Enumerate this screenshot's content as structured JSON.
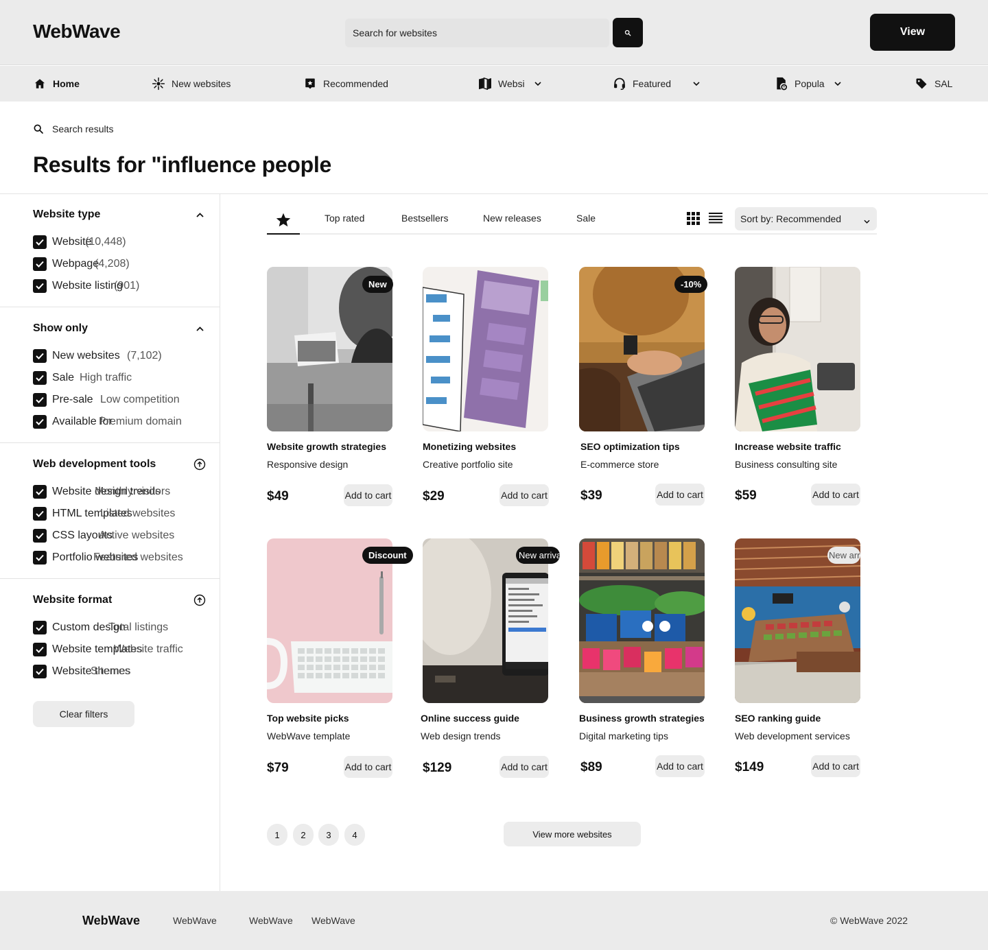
{
  "header": {
    "logo": "WebWave",
    "search_placeholder": "Search for websites",
    "view_label": "View"
  },
  "nav": {
    "items": [
      {
        "label": "Home",
        "icon": "home-icon"
      },
      {
        "label": "New websites",
        "icon": "sparkle-icon"
      },
      {
        "label": "Recommended",
        "icon": "recommend-icon"
      },
      {
        "label": "Websi",
        "icon": "book-icon"
      },
      {
        "label": "Featured",
        "icon": "headset-icon"
      },
      {
        "label": "Popula",
        "icon": "document-badge-icon"
      },
      {
        "label": "SAL",
        "icon": "tag-icon"
      }
    ]
  },
  "breadcrumb": "Search results",
  "page_title": "Results for \"influence people",
  "filters": {
    "website_type": {
      "title": "Website type",
      "options": [
        {
          "label": "Website",
          "count": "(10,448)"
        },
        {
          "label": "Webpage",
          "count": "(4,208)"
        },
        {
          "label": "Website listing",
          "count": "(901)"
        }
      ]
    },
    "show_only": {
      "title": "Show only",
      "options": [
        {
          "label": "New websites",
          "count": "(7,102)"
        },
        {
          "label": "Sale",
          "count": "High traffic"
        },
        {
          "label": "Pre-sale",
          "count": "Low competition"
        },
        {
          "label": "Available for",
          "count": "Premium domain"
        }
      ]
    },
    "web_dev_tools": {
      "title": "Web development tools",
      "options": [
        {
          "label": "Website design trends",
          "count": "Monthly visitors"
        },
        {
          "label": "HTML templates",
          "count": "Listed websites"
        },
        {
          "label": "CSS layouts",
          "count": "Active websites"
        },
        {
          "label": "Portfolio websites",
          "count": "Featured websites"
        }
      ]
    },
    "website_format": {
      "title": "Website format",
      "options": [
        {
          "label": "Custom design",
          "count": "Total listings"
        },
        {
          "label": "Website templates",
          "count": "Website traffic"
        },
        {
          "label": "Website themes",
          "count": "Sitemes"
        }
      ]
    },
    "clear_label": "Clear filters"
  },
  "toolbar": {
    "tabs": [
      "Top rated",
      "Bestsellers",
      "New releases",
      "Sale"
    ],
    "sort_label": "Sort by: Recommended"
  },
  "products": [
    {
      "title": "Website growth strategies",
      "subtitle": "Responsive design",
      "price": "$49",
      "cart": "Add to cart",
      "badge": "New"
    },
    {
      "title": "Monetizing websites",
      "subtitle": "Creative portfolio site",
      "price": "$29",
      "cart": "Add to cart",
      "badge": ""
    },
    {
      "title": "SEO optimization tips",
      "subtitle": "E-commerce store",
      "price": "$39",
      "cart": "Add to cart",
      "badge": "-10%"
    },
    {
      "title": "Increase website traffic",
      "subtitle": "Business consulting site",
      "price": "$59",
      "cart": "Add to cart",
      "badge": ""
    },
    {
      "title": "Top website picks",
      "subtitle": "WebWave template",
      "price": "$79",
      "cart": "Add to cart",
      "badge": "Discount"
    },
    {
      "title": "Online success guide",
      "subtitle": "Web design trends",
      "price": "$129",
      "cart": "Add to cart",
      "badge": "New arriva"
    },
    {
      "title": "Business growth strategies",
      "subtitle": "Digital marketing tips",
      "price": "$89",
      "cart": "Add to cart",
      "badge": ""
    },
    {
      "title": "SEO ranking guide",
      "subtitle": "Web development services",
      "price": "$149",
      "cart": "Add to cart",
      "badge": "New arriva"
    }
  ],
  "pagination": {
    "pages": [
      "1",
      "2",
      "3",
      "4"
    ],
    "more_label": "View more websites"
  },
  "footer": {
    "logo": "WebWave",
    "links": [
      "WebWave",
      "WebWave",
      "WebWave"
    ],
    "copyright": "© WebWave 2022"
  }
}
